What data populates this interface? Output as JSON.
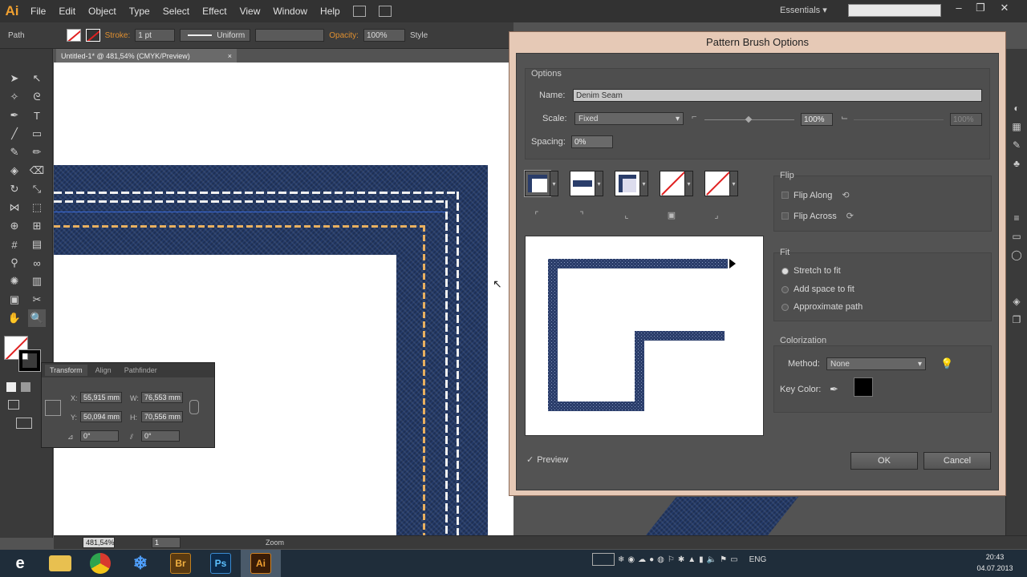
{
  "app": {
    "logo": "Ai",
    "menu": [
      "File",
      "Edit",
      "Object",
      "Type",
      "Select",
      "Effect",
      "View",
      "Window",
      "Help"
    ],
    "workspace": "Essentials",
    "search_placeholder": ""
  },
  "control_bar": {
    "selection_label": "Path",
    "stroke_label": "Stroke:",
    "stroke_weight": "1 pt",
    "profile": "Uniform",
    "opacity_label": "Opacity:",
    "opacity_value": "100%",
    "style_label": "Style"
  },
  "document_tab": {
    "title": "Untitled-1* @ 481,54% (CMYK/Preview)",
    "close": "×"
  },
  "transform_panel": {
    "tabs": [
      "Transform",
      "Align",
      "Pathfinder"
    ],
    "x_label": "X:",
    "x_value": "55,915 mm",
    "y_label": "Y:",
    "y_value": "50,094 mm",
    "w_label": "W:",
    "w_value": "76,553 mm",
    "h_label": "H:",
    "h_value": "70,556 mm",
    "angle_value": "0°",
    "shear_value": "0°"
  },
  "status_bar": {
    "zoom": "481,54%",
    "page": "1",
    "tool": "Zoom"
  },
  "dialog": {
    "title": "Pattern Brush Options",
    "options_group": "Options",
    "name_label": "Name:",
    "name_value": "Denim Seam",
    "scale_label": "Scale:",
    "scale_mode": "Fixed",
    "scale_value": "100%",
    "scale_max_value": "100%",
    "spacing_label": "Spacing:",
    "spacing_value": "0%",
    "flip_group": "Flip",
    "flip_along": "Flip Along",
    "flip_across": "Flip Across",
    "fit_group": "Fit",
    "fit_options": [
      "Stretch to fit",
      "Add space to fit",
      "Approximate path"
    ],
    "fit_selected": 0,
    "colorization_group": "Colorization",
    "method_label": "Method:",
    "method_value": "None",
    "key_color_label": "Key Color:",
    "key_color": "#000000",
    "preview_label": "Preview",
    "ok_label": "OK",
    "cancel_label": "Cancel"
  },
  "taskbar": {
    "apps": [
      {
        "name": "Internet Explorer",
        "icon": "ie-icon",
        "glyph": "e",
        "color": "#1e8ad6"
      },
      {
        "name": "File Explorer",
        "icon": "folder-icon",
        "glyph": "",
        "color": "#e8c050"
      },
      {
        "name": "Chrome",
        "icon": "chrome-icon",
        "glyph": "",
        "color": "#d83a2e"
      },
      {
        "name": "Snowflake",
        "icon": "snowflake-icon",
        "glyph": "❄",
        "color": "#2d7ed6"
      },
      {
        "name": "Bridge",
        "icon": "bridge-icon",
        "glyph": "Br",
        "color": "#5a3a10"
      },
      {
        "name": "Photoshop",
        "icon": "photoshop-icon",
        "glyph": "Ps",
        "color": "#0c2a4a"
      },
      {
        "name": "Illustrator",
        "icon": "illustrator-icon",
        "glyph": "Ai",
        "color": "#3a1c06"
      }
    ],
    "language": "ENG",
    "time": "20:43",
    "date": "04.07.2013"
  },
  "colors": {
    "denim": "#243a68",
    "stitch_white": "#f0f0f0",
    "stitch_gold": "#e8b060",
    "dialog_frame": "#e6c9b6"
  }
}
